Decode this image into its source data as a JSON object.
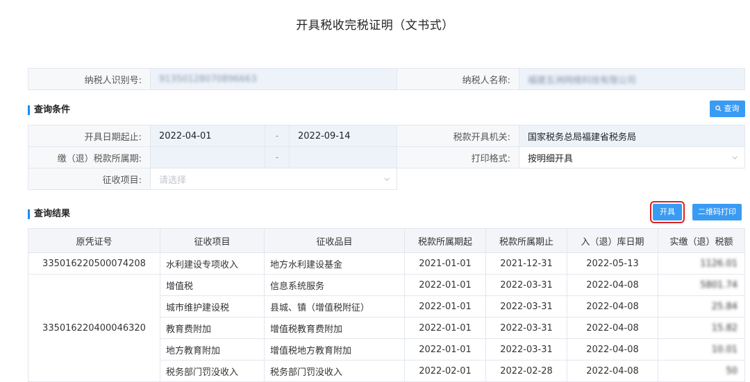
{
  "page": {
    "title": "开具税收完税证明（文书式）"
  },
  "taxpayer": {
    "id_label": "纳税人识别号:",
    "id_value": "91350128070896663",
    "name_label": "纳税人名称:",
    "name_value": "福建五洲网络科技有限公司"
  },
  "query": {
    "section_title": "查询条件",
    "search_button": "查询",
    "search_icon": "search-icon",
    "date_start_label": "开具日期起止:",
    "date_from": "2022-04-01",
    "date_sep": "-",
    "date_to": "2022-09-14",
    "authority_label": "税款开具机关:",
    "authority_value": "国家税务总局福建省税务局",
    "period_label": "缴（退）税款所属期:",
    "period_sep": "-",
    "format_label": "打印格式:",
    "format_value": "按明细开具",
    "item_label": "征收项目:",
    "item_placeholder": "请选择"
  },
  "results": {
    "section_title": "查询结果",
    "open_button": "开具",
    "qr_button": "二维码打印",
    "headers": [
      "原凭证号",
      "征收项目",
      "征收品目",
      "税款所属期起",
      "税款所属期止",
      "入（退）库日期",
      "实缴（退）税额"
    ],
    "rows": [
      {
        "voucher": "335016220500074208",
        "item": "水利建设专项收入",
        "category": "地方水利建设基金",
        "start": "2021-01-01",
        "end": "2021-12-31",
        "date": "2022-05-13",
        "amount": "1126.01"
      },
      {
        "voucher": "335016220400046320",
        "item": "增值税",
        "category": "信息系统服务",
        "start": "2022-01-01",
        "end": "2022-03-31",
        "date": "2022-04-08",
        "amount": "5801.74"
      },
      {
        "voucher": "",
        "item": "城市维护建设税",
        "category": "县城、镇（增值税附征）",
        "start": "2022-01-01",
        "end": "2022-03-31",
        "date": "2022-04-08",
        "amount": "25.84"
      },
      {
        "voucher": "",
        "item": "教育费附加",
        "category": "增值税教育费附加",
        "start": "2022-01-01",
        "end": "2022-03-31",
        "date": "2022-04-08",
        "amount": "15.82"
      },
      {
        "voucher": "",
        "item": "地方教育附加",
        "category": "增值税地方教育附加",
        "start": "2022-01-01",
        "end": "2022-03-31",
        "date": "2022-04-08",
        "amount": "10.01"
      },
      {
        "voucher": "",
        "item": "税务部门罚没收入",
        "category": "税务部门罚没收入",
        "start": "2022-02-01",
        "end": "2022-02-28",
        "date": "2022-04-08",
        "amount": "50"
      }
    ]
  }
}
